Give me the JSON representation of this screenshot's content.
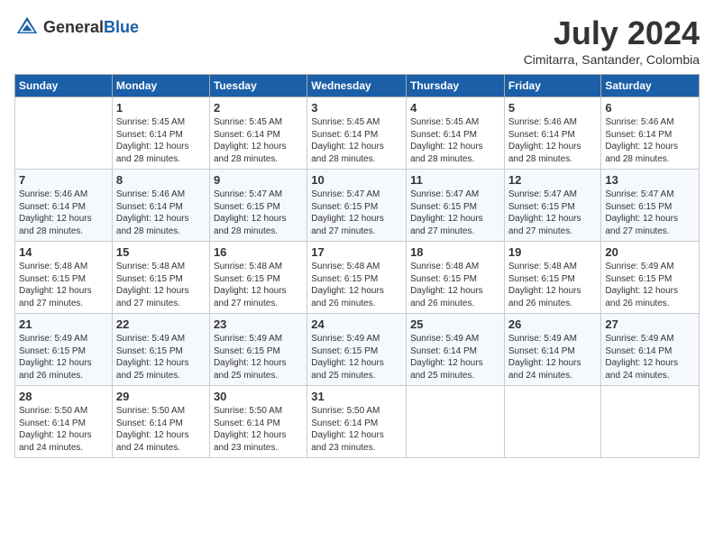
{
  "header": {
    "logo_general": "General",
    "logo_blue": "Blue",
    "title": "July 2024",
    "location": "Cimitarra, Santander, Colombia"
  },
  "columns": [
    "Sunday",
    "Monday",
    "Tuesday",
    "Wednesday",
    "Thursday",
    "Friday",
    "Saturday"
  ],
  "weeks": [
    [
      {
        "day": "",
        "info": ""
      },
      {
        "day": "1",
        "info": "Sunrise: 5:45 AM\nSunset: 6:14 PM\nDaylight: 12 hours\nand 28 minutes."
      },
      {
        "day": "2",
        "info": "Sunrise: 5:45 AM\nSunset: 6:14 PM\nDaylight: 12 hours\nand 28 minutes."
      },
      {
        "day": "3",
        "info": "Sunrise: 5:45 AM\nSunset: 6:14 PM\nDaylight: 12 hours\nand 28 minutes."
      },
      {
        "day": "4",
        "info": "Sunrise: 5:45 AM\nSunset: 6:14 PM\nDaylight: 12 hours\nand 28 minutes."
      },
      {
        "day": "5",
        "info": "Sunrise: 5:46 AM\nSunset: 6:14 PM\nDaylight: 12 hours\nand 28 minutes."
      },
      {
        "day": "6",
        "info": "Sunrise: 5:46 AM\nSunset: 6:14 PM\nDaylight: 12 hours\nand 28 minutes."
      }
    ],
    [
      {
        "day": "7",
        "info": "Sunrise: 5:46 AM\nSunset: 6:14 PM\nDaylight: 12 hours\nand 28 minutes."
      },
      {
        "day": "8",
        "info": "Sunrise: 5:46 AM\nSunset: 6:14 PM\nDaylight: 12 hours\nand 28 minutes."
      },
      {
        "day": "9",
        "info": "Sunrise: 5:47 AM\nSunset: 6:15 PM\nDaylight: 12 hours\nand 28 minutes."
      },
      {
        "day": "10",
        "info": "Sunrise: 5:47 AM\nSunset: 6:15 PM\nDaylight: 12 hours\nand 27 minutes."
      },
      {
        "day": "11",
        "info": "Sunrise: 5:47 AM\nSunset: 6:15 PM\nDaylight: 12 hours\nand 27 minutes."
      },
      {
        "day": "12",
        "info": "Sunrise: 5:47 AM\nSunset: 6:15 PM\nDaylight: 12 hours\nand 27 minutes."
      },
      {
        "day": "13",
        "info": "Sunrise: 5:47 AM\nSunset: 6:15 PM\nDaylight: 12 hours\nand 27 minutes."
      }
    ],
    [
      {
        "day": "14",
        "info": "Sunrise: 5:48 AM\nSunset: 6:15 PM\nDaylight: 12 hours\nand 27 minutes."
      },
      {
        "day": "15",
        "info": "Sunrise: 5:48 AM\nSunset: 6:15 PM\nDaylight: 12 hours\nand 27 minutes."
      },
      {
        "day": "16",
        "info": "Sunrise: 5:48 AM\nSunset: 6:15 PM\nDaylight: 12 hours\nand 27 minutes."
      },
      {
        "day": "17",
        "info": "Sunrise: 5:48 AM\nSunset: 6:15 PM\nDaylight: 12 hours\nand 26 minutes."
      },
      {
        "day": "18",
        "info": "Sunrise: 5:48 AM\nSunset: 6:15 PM\nDaylight: 12 hours\nand 26 minutes."
      },
      {
        "day": "19",
        "info": "Sunrise: 5:48 AM\nSunset: 6:15 PM\nDaylight: 12 hours\nand 26 minutes."
      },
      {
        "day": "20",
        "info": "Sunrise: 5:49 AM\nSunset: 6:15 PM\nDaylight: 12 hours\nand 26 minutes."
      }
    ],
    [
      {
        "day": "21",
        "info": "Sunrise: 5:49 AM\nSunset: 6:15 PM\nDaylight: 12 hours\nand 26 minutes."
      },
      {
        "day": "22",
        "info": "Sunrise: 5:49 AM\nSunset: 6:15 PM\nDaylight: 12 hours\nand 25 minutes."
      },
      {
        "day": "23",
        "info": "Sunrise: 5:49 AM\nSunset: 6:15 PM\nDaylight: 12 hours\nand 25 minutes."
      },
      {
        "day": "24",
        "info": "Sunrise: 5:49 AM\nSunset: 6:15 PM\nDaylight: 12 hours\nand 25 minutes."
      },
      {
        "day": "25",
        "info": "Sunrise: 5:49 AM\nSunset: 6:14 PM\nDaylight: 12 hours\nand 25 minutes."
      },
      {
        "day": "26",
        "info": "Sunrise: 5:49 AM\nSunset: 6:14 PM\nDaylight: 12 hours\nand 24 minutes."
      },
      {
        "day": "27",
        "info": "Sunrise: 5:49 AM\nSunset: 6:14 PM\nDaylight: 12 hours\nand 24 minutes."
      }
    ],
    [
      {
        "day": "28",
        "info": "Sunrise: 5:50 AM\nSunset: 6:14 PM\nDaylight: 12 hours\nand 24 minutes."
      },
      {
        "day": "29",
        "info": "Sunrise: 5:50 AM\nSunset: 6:14 PM\nDaylight: 12 hours\nand 24 minutes."
      },
      {
        "day": "30",
        "info": "Sunrise: 5:50 AM\nSunset: 6:14 PM\nDaylight: 12 hours\nand 23 minutes."
      },
      {
        "day": "31",
        "info": "Sunrise: 5:50 AM\nSunset: 6:14 PM\nDaylight: 12 hours\nand 23 minutes."
      },
      {
        "day": "",
        "info": ""
      },
      {
        "day": "",
        "info": ""
      },
      {
        "day": "",
        "info": ""
      }
    ]
  ]
}
